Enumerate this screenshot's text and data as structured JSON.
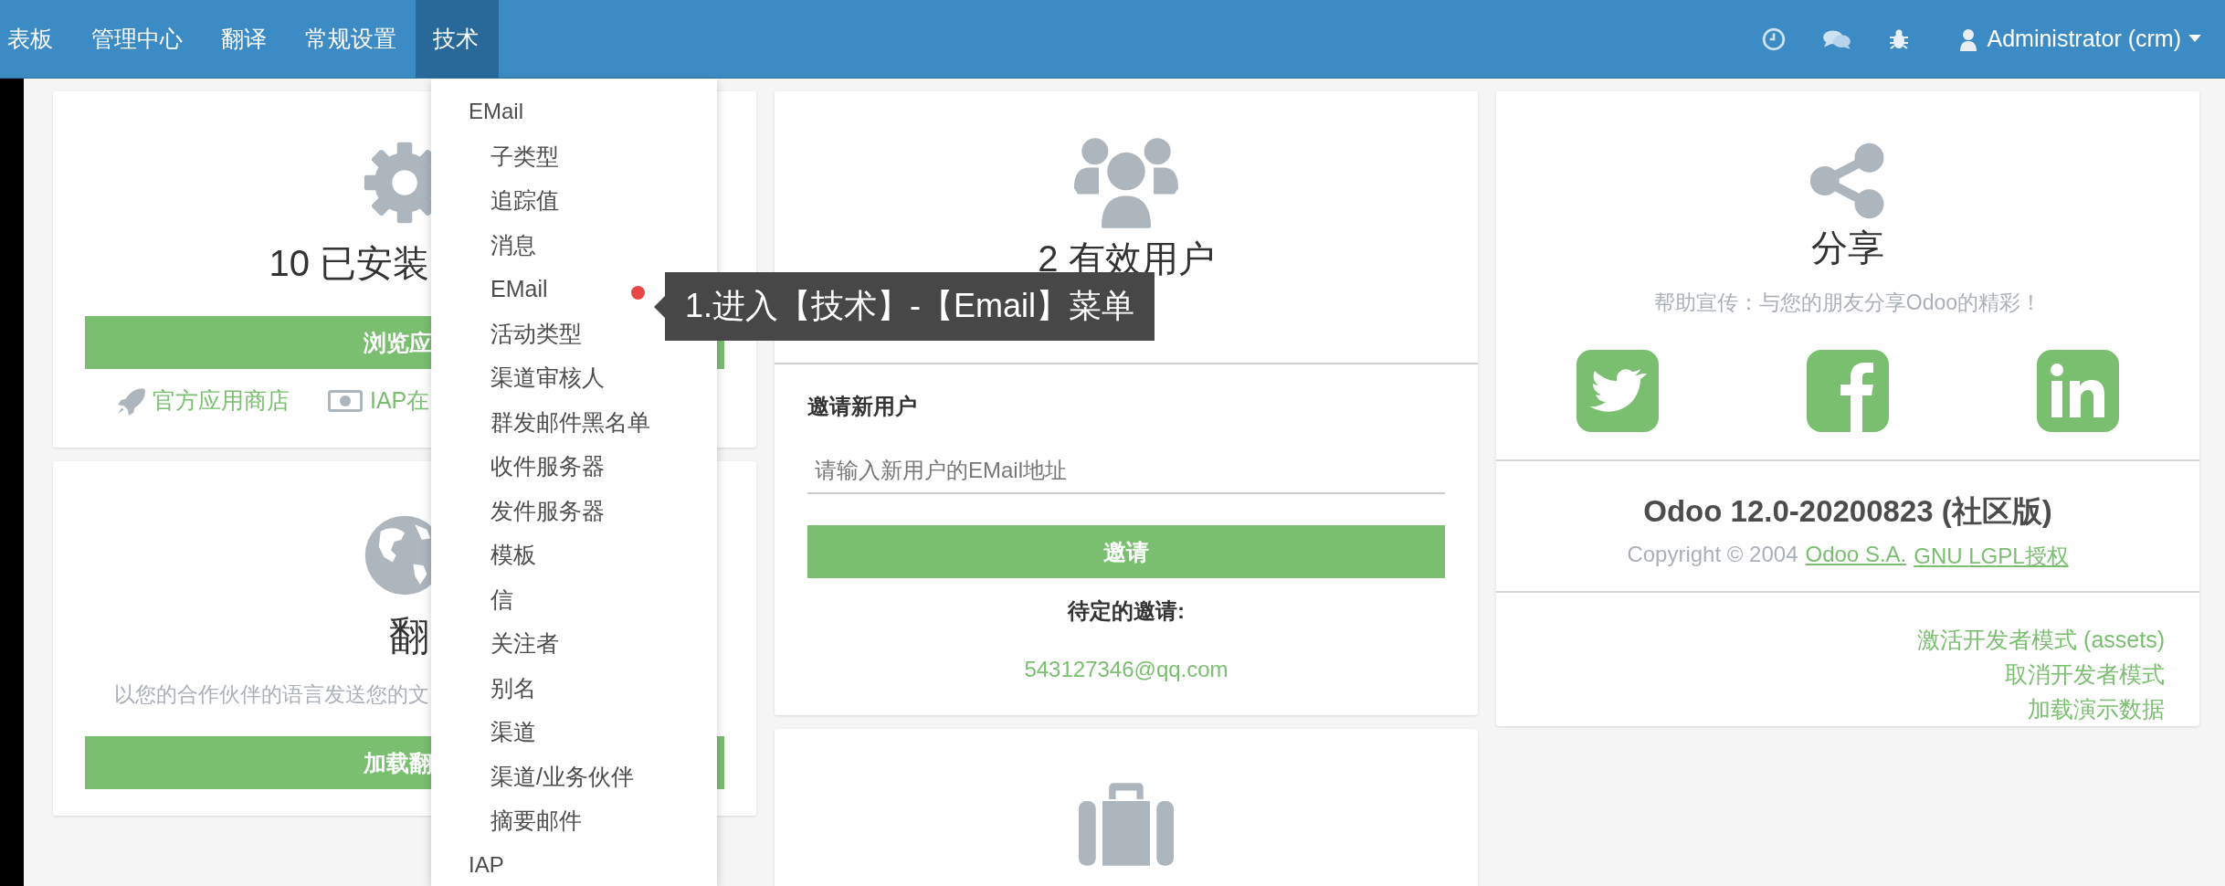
{
  "navbar": {
    "menu_items": [
      {
        "label": "表板",
        "selected": false
      },
      {
        "label": "管理中心",
        "selected": false
      },
      {
        "label": "翻译",
        "selected": false
      },
      {
        "label": "常规设置",
        "selected": false
      },
      {
        "label": "技术",
        "selected": true
      }
    ],
    "user": {
      "name": "Administrator (crm)"
    }
  },
  "dropdown": {
    "sections": [
      {
        "header": "EMail",
        "items": [
          "子类型",
          "追踪值",
          "消息",
          "EMail",
          "活动类型",
          "渠道审核人",
          "群发邮件黑名单",
          "收件服务器",
          "发件服务器",
          "模板",
          "信",
          "关注者",
          "别名",
          "渠道",
          "渠道/业务伙伴",
          "摘要邮件"
        ]
      },
      {
        "header": "IAP"
      }
    ]
  },
  "annotation": {
    "text": "1.进入【技术】-【Email】菜单"
  },
  "apps_card": {
    "title": "10 已安装",
    "button": "浏览应",
    "links": [
      {
        "kind": "store",
        "label": "官方应用商店"
      },
      {
        "kind": "iap",
        "label": "IAP在"
      }
    ]
  },
  "translation_card": {
    "title": "翻",
    "description": "以您的合作伙伴的语言发送您的文",
    "button": "加载翻"
  },
  "users_card": {
    "title": "2 有效用户",
    "invite_heading": "邀请新用户",
    "email_field": {
      "placeholder": "请输入新用户的EMail地址"
    },
    "invite_button": "邀请",
    "pending_heading": "待定的邀请:",
    "pending": [
      "543127346@qq.com"
    ]
  },
  "share_card": {
    "title": "分享",
    "text": "帮助宣传：与您的朋友分享Odoo的精彩！",
    "networks": [
      {
        "kind": "twitter"
      },
      {
        "kind": "facebook"
      },
      {
        "kind": "linkedin"
      }
    ]
  },
  "version": {
    "title": "Odoo 12.0-20200823 (社区版)",
    "copyright": "Copyright © 2004",
    "links": [
      "Odoo S.A.",
      "GNU LGPL授权"
    ]
  },
  "developer_links": [
    "激活开发者模式 (assets)",
    "取消开发者模式",
    "加载演示数据"
  ]
}
